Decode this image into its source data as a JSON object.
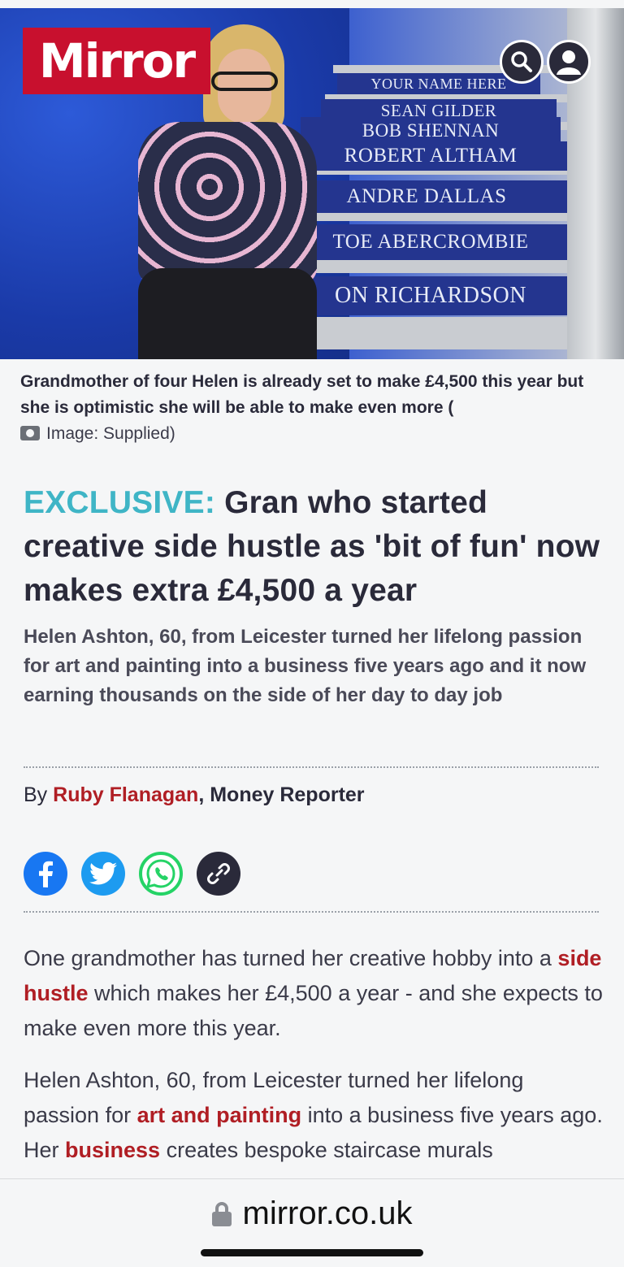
{
  "header": {
    "logo": "Mirror",
    "search_icon": "search-icon",
    "account_icon": "user-icon"
  },
  "hero": {
    "stair_names": [
      "YOUR NAME HERE",
      "SEAN GILDER",
      "BOB SHENNAN",
      "ROBERT ALTHAM",
      "ANDRE DALLAS",
      "TOE ABERCROMBIE",
      "ON RICHARDSON"
    ]
  },
  "caption": {
    "text": "Grandmother of four Helen is already set to make £4,500 this year but she is optimistic she will be able to make even more (",
    "credit": "Image: Supplied)"
  },
  "article": {
    "kicker": "EXCLUSIVE:",
    "headline": "Gran who started creative side hustle as 'bit of fun' now makes extra £4,500 a year",
    "standfirst": "Helen Ashton, 60, from Leicester turned her lifelong passion for art and painting into a business five years ago and it now earning thousands on the side of her day to day job",
    "byline_prefix": "By",
    "author": "Ruby Flanagan",
    "role": ", Money Reporter",
    "p1_a": "One grandmother has turned her creative hobby into a",
    "p1_link": "side hustle",
    "p1_b": "which makes her £4,500 a year - and she expects to make even more this year.",
    "p2_a": "Helen Ashton, 60, from Leicester turned her lifelong passion for",
    "p2_link1": "art and painting",
    "p2_b": "into a business five years ago. Her",
    "p2_link2": "business",
    "p2_c": "creates bespoke staircase murals"
  },
  "share": {
    "icons": [
      "facebook-icon",
      "twitter-icon",
      "whatsapp-icon",
      "link-icon"
    ],
    "colors": {
      "facebook": "#1877f2",
      "twitter": "#1d9bf0",
      "whatsapp": "#25d366",
      "link": "#2a2a3a"
    }
  },
  "browser": {
    "url": "mirror.co.uk"
  },
  "colors": {
    "brand": "#c8102e",
    "kicker": "#3fb5c6",
    "link": "#b01e24"
  }
}
